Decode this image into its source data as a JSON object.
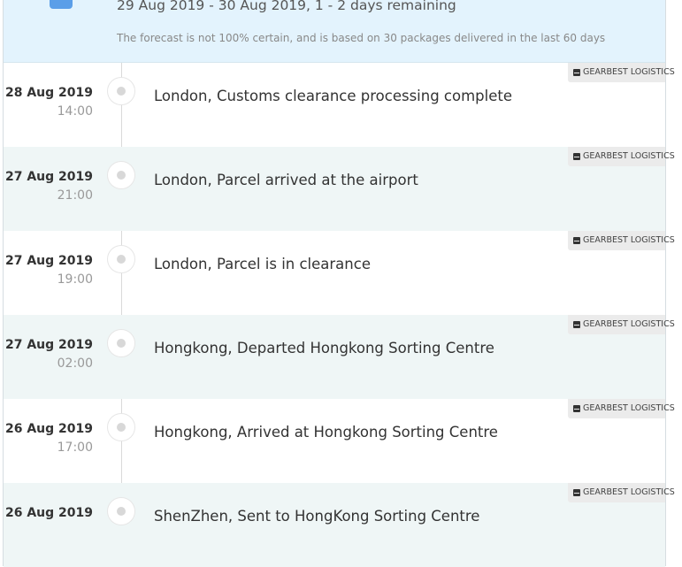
{
  "forecast": {
    "range_text": "29 Aug 2019 - 30 Aug 2019, 1 - 2 days remaining",
    "note": "The forecast is not 100% certain, and is based on 30 packages delivered in the last 60 days",
    "icon": "calendar-icon"
  },
  "events": [
    {
      "date": "28 Aug 2019",
      "time": "14:00",
      "text": "London, Customs clearance processing complete",
      "carrier": "GEARBEST LOGISTICS"
    },
    {
      "date": "27 Aug 2019",
      "time": "21:00",
      "text": "London, Parcel arrived at the airport",
      "carrier": "GEARBEST LOGISTICS"
    },
    {
      "date": "27 Aug 2019",
      "time": "19:00",
      "text": "London, Parcel is in clearance",
      "carrier": "GEARBEST LOGISTICS"
    },
    {
      "date": "27 Aug 2019",
      "time": "02:00",
      "text": "Hongkong, Departed Hongkong Sorting Centre",
      "carrier": "GEARBEST LOGISTICS"
    },
    {
      "date": "26 Aug 2019",
      "time": "17:00",
      "text": "Hongkong, Arrived at Hongkong Sorting Centre",
      "carrier": "GEARBEST LOGISTICS"
    },
    {
      "date": "26 Aug 2019",
      "time": "",
      "text": "ShenZhen, Sent to HongKong Sorting Centre",
      "carrier": "GEARBEST LOGISTICS"
    }
  ],
  "colors": {
    "forecast_bg": "#e3f3fd",
    "row_alt_bg": "#eff6f6",
    "calendar_icon": "#5b9ee8",
    "carrier_badge_bg": "#ebebeb"
  }
}
